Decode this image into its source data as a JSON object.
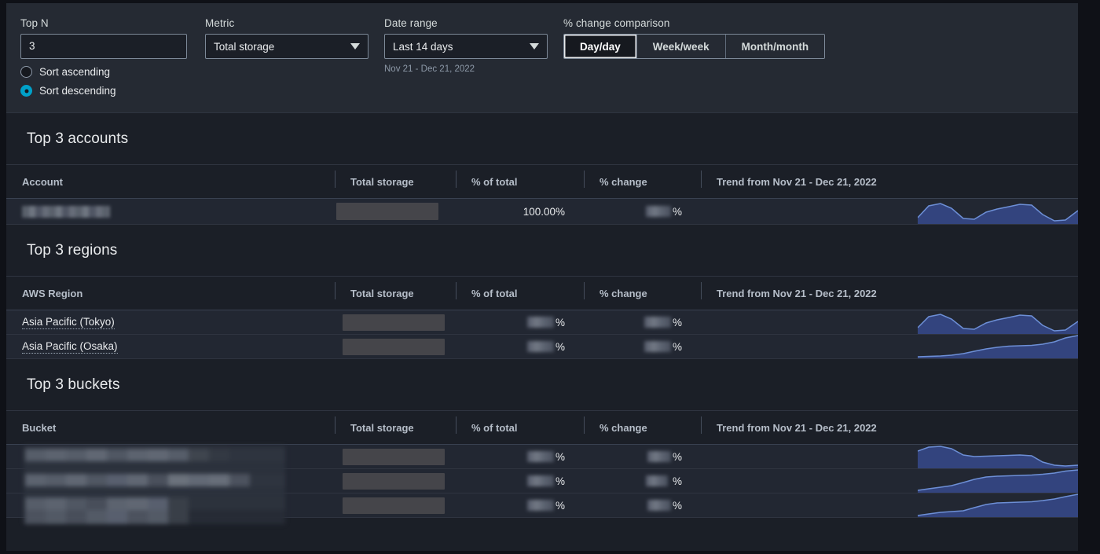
{
  "filters": {
    "topn": {
      "label": "Top N",
      "value": "3"
    },
    "metric": {
      "label": "Metric",
      "value": "Total storage",
      "caret": "chevron-down-icon"
    },
    "date_range": {
      "label": "Date range",
      "value": "Last 14 days",
      "helper": "Nov 21 - Dec 21, 2022",
      "caret": "chevron-down-icon"
    },
    "sort": {
      "ascending_label": "Sort ascending",
      "descending_label": "Sort descending",
      "selected": "descending"
    },
    "comparison": {
      "label": "% change comparison",
      "options": [
        "Day/day",
        "Week/week",
        "Month/month"
      ],
      "selected": "Day/day"
    }
  },
  "colors": {
    "accent": "#00a1c9",
    "spark_fill": "#33447e",
    "spark_stroke": "#6d8fd6",
    "panel_bg": "#252a33",
    "section_bg": "#1b1f27",
    "row_bg": "#222732",
    "redaction": "#45454a"
  },
  "sections": [
    {
      "title": "Top 3 accounts",
      "columns": [
        "Account",
        "Total storage",
        "% of total",
        "% change",
        "Trend from Nov 21 - Dec 21, 2022"
      ],
      "rows": [
        {
          "name": "[redacted]",
          "name_redacted": true,
          "storage": "[redacted]",
          "storage_redacted": true,
          "pct_of_total": "100.00%",
          "pct_redacted": false,
          "pct_change": "[redacted]%",
          "change_redacted": true
        }
      ]
    },
    {
      "title": "Top 3 regions",
      "columns": [
        "AWS Region",
        "Total storage",
        "% of total",
        "% change",
        "Trend from Nov 21 - Dec 21, 2022"
      ],
      "rows": [
        {
          "name": "Asia Pacific (Tokyo)",
          "name_redacted": false,
          "storage": "[redacted]",
          "storage_redacted": true,
          "pct_of_total": "[redacted]%",
          "pct_redacted": true,
          "pct_change": "[redacted]%",
          "change_redacted": true
        },
        {
          "name": "Asia Pacific (Osaka)",
          "name_redacted": false,
          "storage": "[redacted]",
          "storage_redacted": true,
          "pct_of_total": "[redacted]%",
          "pct_redacted": true,
          "pct_change": "[redacted]%",
          "change_redacted": true
        }
      ]
    },
    {
      "title": "Top 3 buckets",
      "columns": [
        "Bucket",
        "Total storage",
        "% of total",
        "% change",
        "Trend from Nov 21 - Dec 21, 2022"
      ],
      "rows": [
        {
          "name": "[redacted]",
          "name_redacted": true,
          "storage": "[redacted]",
          "storage_redacted": true,
          "pct_of_total": "[redacted]%",
          "pct_redacted": true,
          "pct_change": "[redacted]%",
          "change_redacted": true
        },
        {
          "name": "[redacted]",
          "name_redacted": true,
          "storage": "[redacted]",
          "storage_redacted": true,
          "pct_of_total": "[redacted]%",
          "pct_redacted": true,
          "pct_change": "[redacted]%",
          "change_redacted": true
        },
        {
          "name": "[redacted]",
          "name_redacted": true,
          "storage": "[redacted]",
          "storage_redacted": true,
          "pct_of_total": "[redacted]%",
          "pct_redacted": true,
          "pct_change": "[redacted]%",
          "change_redacted": true
        }
      ]
    }
  ],
  "chart_data": [
    {
      "type": "area",
      "title": "Trend from Nov 21 - Dec 21, 2022",
      "series_name": "account-trend",
      "x": [
        0,
        1,
        2,
        3,
        4,
        5,
        6,
        7,
        8,
        9,
        10,
        11,
        12,
        13
      ],
      "values": [
        34,
        70,
        78,
        62,
        24,
        22,
        46,
        58,
        66,
        74,
        70,
        40,
        16,
        18,
        48
      ],
      "ylim": [
        0,
        100
      ],
      "grid": false,
      "legend": false
    },
    {
      "type": "area",
      "title": "Trend from Nov 21 - Dec 21, 2022",
      "series_name": "region-tokyo-trend",
      "x": [
        0,
        1,
        2,
        3,
        4,
        5,
        6,
        7,
        8,
        9,
        10,
        11,
        12,
        13
      ],
      "values": [
        34,
        70,
        78,
        62,
        24,
        22,
        46,
        58,
        66,
        74,
        70,
        40,
        16,
        18,
        48
      ],
      "ylim": [
        0,
        100
      ],
      "grid": false,
      "legend": false
    },
    {
      "type": "area",
      "title": "Trend from Nov 21 - Dec 21, 2022",
      "series_name": "region-osaka-trend",
      "x": [
        0,
        1,
        2,
        3,
        4,
        5,
        6,
        7,
        8,
        9,
        10,
        11,
        12,
        13
      ],
      "values": [
        6,
        7,
        8,
        10,
        18,
        26,
        34,
        40,
        44,
        46,
        48,
        52,
        62,
        78,
        88
      ],
      "ylim": [
        0,
        100
      ],
      "grid": false,
      "legend": false
    },
    {
      "type": "area",
      "title": "Trend from Nov 21 - Dec 21, 2022",
      "series_name": "bucket-1-trend",
      "x": [
        0,
        1,
        2,
        3,
        4,
        5,
        6,
        7,
        8,
        9,
        10,
        11,
        12,
        13
      ],
      "values": [
        70,
        86,
        90,
        80,
        56,
        48,
        50,
        52,
        54,
        56,
        50,
        26,
        12,
        10,
        14
      ],
      "ylim": [
        0,
        100
      ],
      "grid": false,
      "legend": false
    },
    {
      "type": "area",
      "title": "Trend from Nov 21 - Dec 21, 2022",
      "series_name": "bucket-2-trend",
      "x": [
        0,
        1,
        2,
        3,
        4,
        5,
        6,
        7,
        8,
        9,
        10,
        11,
        12,
        13
      ],
      "values": [
        8,
        14,
        20,
        26,
        38,
        50,
        60,
        64,
        66,
        68,
        70,
        74,
        80,
        88,
        94
      ],
      "ylim": [
        0,
        100
      ],
      "grid": false,
      "legend": false
    },
    {
      "type": "area",
      "title": "Trend from Nov 21 - Dec 21, 2022",
      "series_name": "bucket-3-trend",
      "x": [
        0,
        1,
        2,
        3,
        4,
        5,
        6,
        7,
        8,
        9,
        10,
        11,
        12,
        13
      ],
      "values": [
        4,
        12,
        20,
        24,
        28,
        42,
        54,
        60,
        62,
        64,
        66,
        70,
        76,
        84,
        94
      ],
      "ylim": [
        0,
        100
      ],
      "grid": false,
      "legend": false
    }
  ]
}
